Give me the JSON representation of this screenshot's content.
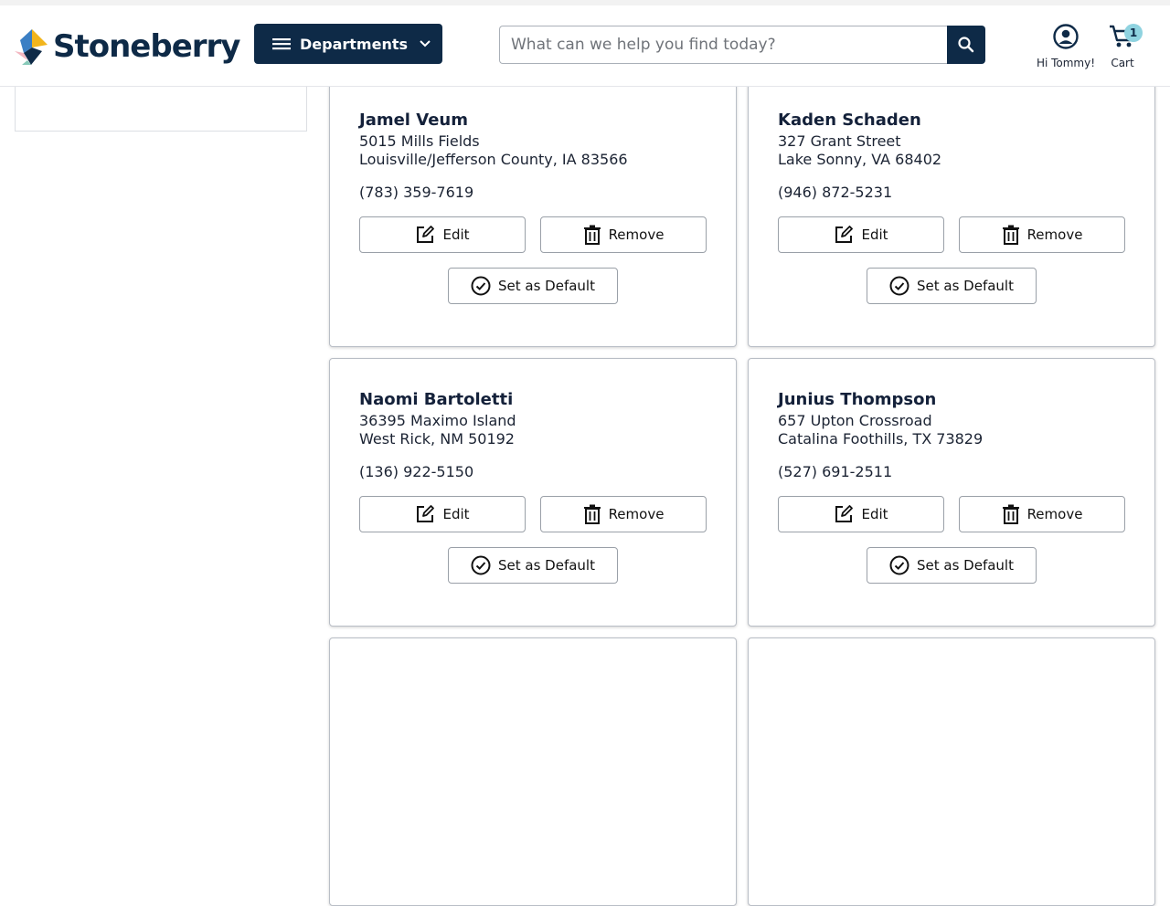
{
  "brand": {
    "name": "Stoneberry",
    "colors": {
      "navy": "#0e2a47",
      "accent_blue": "#3b7fc4",
      "accent_yellow": "#f2b51c",
      "accent_pink": "#f3b6c0",
      "accent_teal": "#86c9b8",
      "badge": "#8fd3e0"
    }
  },
  "header": {
    "departments_label": "Departments",
    "search_placeholder": "What can we help you find today?",
    "account_label": "Hi Tommy!",
    "cart_label": "Cart",
    "cart_count": "1",
    "icons": [
      "menu-icon",
      "chevron-down-icon",
      "search-icon",
      "user-circle-icon",
      "cart-icon"
    ]
  },
  "addresses": [
    {
      "name": "Jamel Veum",
      "line1": "5015 Mills Fields",
      "line2": "Louisville/Jefferson County, IA 83566",
      "phone": "(783) 359-7619"
    },
    {
      "name": "Kaden Schaden",
      "line1": "327 Grant Street",
      "line2": "Lake Sonny, VA 68402",
      "phone": "(946) 872-5231"
    },
    {
      "name": "Naomi Bartoletti",
      "line1": "36395 Maximo Island",
      "line2": "West Rick, NM 50192",
      "phone": "(136) 922-5150"
    },
    {
      "name": "Junius Thompson",
      "line1": "657 Upton Crossroad",
      "line2": "Catalina Foothills, TX 73829",
      "phone": "(527) 691-2511"
    }
  ],
  "card_actions": {
    "edit_label": "Edit",
    "remove_label": "Remove",
    "default_label": "Set as Default"
  }
}
